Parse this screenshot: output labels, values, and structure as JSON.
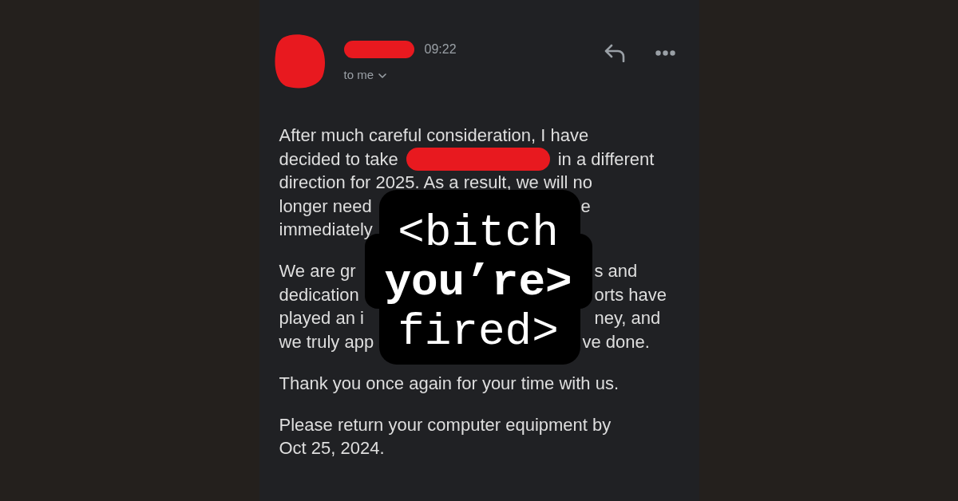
{
  "header": {
    "sender": {
      "avatar_redacted": true,
      "name_redacted": true
    },
    "time": "09:22",
    "recipients": "to me"
  },
  "body": {
    "paragraphs": [
      {
        "kind": "lines",
        "lines": [
          {
            "kind": "full",
            "text": "After much careful consideration, I have"
          },
          {
            "kind": "redacted",
            "before": "decided to take",
            "after": "in a different"
          },
          {
            "kind": "full",
            "text": "direction for 2025. As a result, we will no"
          },
          {
            "kind": "covered",
            "left": "longer need",
            "right": "e"
          },
          {
            "kind": "covered",
            "left": "immediately"
          }
        ]
      },
      {
        "kind": "lines",
        "lines": [
          {
            "kind": "covered",
            "left": "We are gr",
            "right": "s and"
          },
          {
            "kind": "covered",
            "left": "dedication",
            "right": "orts have"
          },
          {
            "kind": "covered",
            "left": "played an i",
            "right": "ney, and"
          },
          {
            "kind": "covered",
            "left": "we truly app",
            "right": "ve done."
          }
        ]
      },
      {
        "kind": "text",
        "text": "Thank you once again for your time with us."
      },
      {
        "kind": "text",
        "text": "Please return your computer equipment by Oct 25, 2024."
      }
    ]
  },
  "sticker": {
    "lines": [
      {
        "text": "<bitch",
        "bold": false
      },
      {
        "text": "you’re>",
        "bold": true
      },
      {
        "text": "fired>",
        "bold": false
      }
    ]
  }
}
